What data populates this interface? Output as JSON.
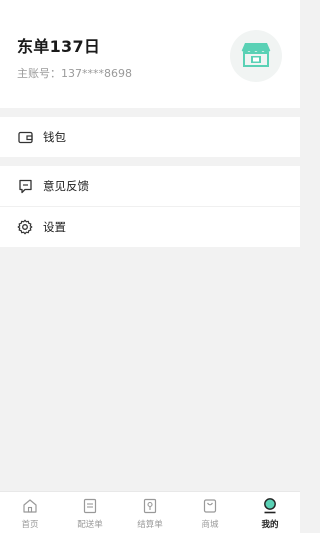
{
  "profile": {
    "store_name": "东单137日",
    "account_label": "主账号：137****8698"
  },
  "menu": {
    "wallet": "钱包",
    "feedback": "意见反馈",
    "settings": "设置"
  },
  "tabbar": {
    "items": [
      {
        "label": "首页",
        "icon": "home-icon"
      },
      {
        "label": "配送单",
        "icon": "delivery-list-icon"
      },
      {
        "label": "结算单",
        "icon": "settlement-icon"
      },
      {
        "label": "商城",
        "icon": "shop-bag-icon"
      },
      {
        "label": "我的",
        "icon": "profile-icon",
        "active": true
      }
    ]
  },
  "colors": {
    "accent": "#5ad1b5",
    "background": "#f2f2f2"
  }
}
